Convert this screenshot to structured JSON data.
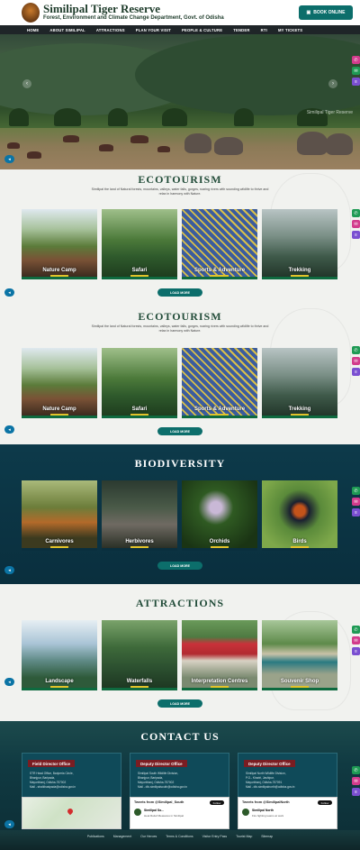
{
  "header": {
    "title": "Similipal Tiger Reserve",
    "subtitle": "Forest, Environment and Climate Change Department, Govt. of Odisha",
    "book_label": "BOOK ONLINE"
  },
  "nav": [
    "HOME",
    "ABOUT SIMILIPAL",
    "ATTRACTIONS",
    "PLAN YOUR VISIT",
    "PEOPLE & CULTURE",
    "TENDER",
    "RTI",
    "MY TICKETS"
  ],
  "hero": {
    "caption": "Similipal Tiger Reserve"
  },
  "ecotourism": {
    "title": "ECOTOURISM",
    "desc": "Similipal the land of Natural forests, mountains, valleys, water falls, gorges, roaring rivers with sounding wildlife to thrive and relax in harmony with Nature.",
    "cards": [
      "Nature Camp",
      "Safari",
      "Sports & Adventure",
      "Trekking"
    ],
    "more": "LOAD MORE"
  },
  "ecotourism2": {
    "title": "ECOTOURISM",
    "desc": "Similipal the land of Natural forests, mountains, valleys, water falls, gorges, roaring rivers with sounding wildlife to thrive and relax in harmony with Nature.",
    "cards": [
      "Nature Camp",
      "Safari",
      "Sports & Adventure",
      "Trekking"
    ],
    "more": "LOAD MORE"
  },
  "biodiversity": {
    "title": "BIODIVERSITY",
    "cards": [
      "Carnivores",
      "Herbivores",
      "Orchids",
      "Birds"
    ],
    "more": "LOAD MORE"
  },
  "attractions": {
    "title": "ATTRACTIONS",
    "cards": [
      "Landscape",
      "Waterfalls",
      "Interpretation Centres",
      "Souvenir Shop"
    ],
    "more": "LOAD MORE"
  },
  "contact": {
    "title": "CONTACT US",
    "offices": [
      {
        "name": "Field Director Office",
        "lines": [
          "STR Head Office, Bariperia Circle,",
          "Bhanjpur, Baripada,",
          "Mayurbhanj, Odisha-757002",
          "Mail - stralkhasipada@odisha.gov.in"
        ]
      },
      {
        "name": "Deputy Director Office",
        "lines": [
          "Similipal South Wildlife Division,",
          "Bhanjpur, Baripada,",
          "Mayurbhanj, Odisha-757002",
          "Mail - dfo.similipalsouth@odisha.gov.in"
        ]
      },
      {
        "name": "Deputy Director Office",
        "lines": [
          "Similipal North Wildlife Division,",
          "P.O.- Khariri, Jashipur,",
          "Mayurbhanj, Odisha-757091",
          "Mail - dfo.similipalnorth@odisha.gov.in"
        ]
      }
    ],
    "tweets": [
      {
        "head": "Tweets from @Similipal_South",
        "follow": "Follow",
        "author": "Similipal So...",
        "text": "Heat Relief Measures in Similipal"
      },
      {
        "head": "Tweets from @SimilipalNorth",
        "follow": "Follow",
        "author": "Similipal North",
        "text": "Fire fighting teams at work"
      }
    ]
  },
  "footer": [
    "Publications",
    "Management",
    "Our Heroes",
    "Terms & Conditions",
    "Visitor Entry Pass",
    "Tourist Map",
    "Sitemap"
  ]
}
